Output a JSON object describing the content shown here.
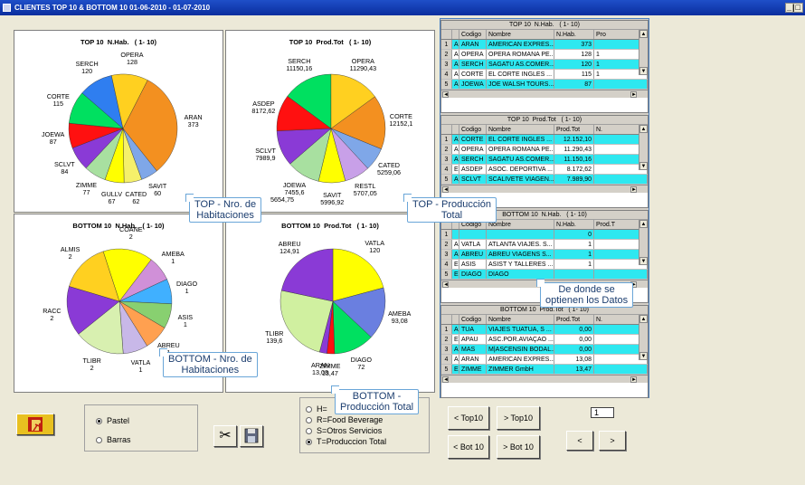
{
  "window": {
    "title": "CLIENTES TOP 10 & BOTTOM 10  01-06-2010 - 01-07-2010",
    "controls": "_|□"
  },
  "charts": {
    "top_hab": {
      "title": "TOP 10  N.Hab.   ( 1- 10)",
      "chart_data": {
        "type": "pie",
        "title": "TOP 10  N.Hab.   ( 1- 10)",
        "categories": [
          "ARAN",
          "SAVIT",
          "CATED",
          "GULLV",
          "ZIMME",
          "SCLVT",
          "JOEWA",
          "CORTE",
          "SERCH",
          "OPERA"
        ],
        "values": [
          373,
          60,
          62,
          67,
          77,
          84,
          87,
          115,
          120,
          128
        ],
        "colors": [
          "#f39020",
          "#7fa7e8",
          "#f5f06a",
          "#ffff00",
          "#a8e0a0",
          "#8a3ad6",
          "#ff1010",
          "#00e060",
          "#2f7ef0",
          "#ffd020"
        ]
      }
    },
    "top_prod": {
      "title": "TOP 10  Prod.Tot   ( 1- 10)",
      "chart_data": {
        "type": "pie",
        "title": "TOP 10  Prod.Tot   ( 1- 10)",
        "categories": [
          "CORTE",
          "CATED",
          "RESTL",
          "SAVIT",
          "JOEWA",
          "SCLVT",
          "ASDEP",
          "SERCH",
          "OPERA"
        ],
        "values": [
          12152.1,
          5259.06,
          5707.05,
          5996.92,
          7455.6,
          7989.9,
          8172.62,
          11150.16,
          11290.43
        ],
        "value_labels": [
          "12152,1",
          "5259,06",
          "5707,05",
          "5996,92",
          "7455,6",
          "7989,9",
          "8172,62",
          "11150,16",
          "11290,43"
        ],
        "extra_label": "5654,75",
        "colors": [
          "#f39020",
          "#7fa7e8",
          "#c8a0e8",
          "#ffff00",
          "#a8e0a0",
          "#8a3ad6",
          "#ff1010",
          "#00e060",
          "#ffd020"
        ]
      }
    },
    "bot_hab": {
      "title": "BOTTOM 10  N.Hab.   ( 1- 10)",
      "chart_data": {
        "type": "pie",
        "title": "BOTTOM 10  N.Hab.   ( 1- 10)",
        "categories": [
          "COANE",
          "AMEBA",
          "DIAGO",
          "ASIS",
          "ABREU",
          "VATLA",
          "TLIBR",
          "RACC",
          "ALMIS"
        ],
        "values": [
          2,
          1,
          1,
          1,
          1,
          1,
          2,
          2,
          2
        ],
        "colors": [
          "#ffff00",
          "#d090d8",
          "#40b0ff",
          "#88d070",
          "#ffa050",
          "#c8b8e8",
          "#d8f0b0",
          "#8a3ad6",
          "#ffd020"
        ]
      }
    },
    "bot_prod": {
      "title": "BOTTOM 10  Prod.Tot   ( 1- 10)",
      "chart_data": {
        "type": "pie",
        "title": "BOTTOM 10  Prod.Tot   ( 1- 10)",
        "categories": [
          "VATLA",
          "AMEBA",
          "DIAGO",
          "ZIMME",
          "ARAN",
          "TLIBR",
          "ABREU"
        ],
        "values": [
          120,
          93.08,
          72,
          13.47,
          13.08,
          139.6,
          124.91
        ],
        "value_labels": [
          "120",
          "93,08",
          "72",
          "13,47",
          "13,08",
          "139,6",
          "124,91"
        ],
        "colors": [
          "#ffff00",
          "#6a7fe0",
          "#00e060",
          "#ff1010",
          "#8a3ad6",
          "#d0f0a0",
          "#8a3ad6"
        ]
      }
    }
  },
  "callouts": {
    "top_hab": "TOP - Nro. de\nHabitaciones",
    "top_prod": "TOP - Producción\nTotal",
    "bot_hab": "BOTTOM - Nro. de\nHabitaciones",
    "bot_prod": "BOTTOM -\nProducción Total",
    "datos": "De donde se\noptienen los Datos"
  },
  "grids": [
    {
      "title": "TOP 10  N.Hab.   ( 1- 10)",
      "headers": [
        "",
        "",
        "Codigo",
        "Nombre",
        "N.Hab.",
        "Pro"
      ],
      "rows": [
        {
          "n": "1",
          "t": "A",
          "code": "ARAN",
          "name": "AMERICAN EXPRES...",
          "val": "373",
          "extra": "",
          "hl": true
        },
        {
          "n": "2",
          "t": "A",
          "code": "OPERA",
          "name": "OPERA ROMANA PE...",
          "val": "128",
          "extra": "1",
          "hl": false
        },
        {
          "n": "3",
          "t": "A",
          "code": "SERCH",
          "name": "SAGATU AS.COMER...",
          "val": "120",
          "extra": "1",
          "hl": true
        },
        {
          "n": "4",
          "t": "A",
          "code": "CORTE",
          "name": "EL CORTE INGLES ...",
          "val": "115",
          "extra": "1",
          "hl": false
        },
        {
          "n": "5",
          "t": "A",
          "code": "JOEWA",
          "name": "JOE WALSH TOURS...",
          "val": "87",
          "extra": "",
          "hl": true
        }
      ]
    },
    {
      "title": "TOP 10  Prod.Tot   ( 1- 10)",
      "headers": [
        "",
        "",
        "Codigo",
        "Nombre",
        "Prod.Tot",
        "N."
      ],
      "rows": [
        {
          "n": "1",
          "t": "A",
          "code": "CORTE",
          "name": "EL CORTE INGLES ...",
          "val": "12.152,10",
          "extra": "",
          "hl": true
        },
        {
          "n": "2",
          "t": "A",
          "code": "OPERA",
          "name": "OPERA ROMANA PE...",
          "val": "11.290,43",
          "extra": "",
          "hl": false
        },
        {
          "n": "3",
          "t": "A",
          "code": "SERCH",
          "name": "SAGATU AS.COMER...",
          "val": "11.150,16",
          "extra": "",
          "hl": true
        },
        {
          "n": "4",
          "t": "E",
          "code": "ASDEP",
          "name": "ASOC. DEPORTIVA ...",
          "val": "8.172,62",
          "extra": "",
          "hl": false
        },
        {
          "n": "5",
          "t": "A",
          "code": "SCLVT",
          "name": "SCALIVETE VIAGEN...",
          "val": "7.989,90",
          "extra": "",
          "hl": true
        }
      ]
    },
    {
      "title": "BOTTOM 10  N.Hab.   ( 1- 10)",
      "headers": [
        "",
        "",
        "Codigo",
        "Nombre",
        "N.Hab.",
        "Prod.T"
      ],
      "rows": [
        {
          "n": "1",
          "t": "",
          "code": "",
          "name": "",
          "val": "0",
          "extra": "",
          "hl": true
        },
        {
          "n": "2",
          "t": "A",
          "code": "VATLA",
          "name": "ATLANTA VIAJES. S...",
          "val": "1",
          "extra": "",
          "hl": false
        },
        {
          "n": "3",
          "t": "A",
          "code": "ABREU",
          "name": "ABREU VIAGENS S...",
          "val": "1",
          "extra": "",
          "hl": true
        },
        {
          "n": "4",
          "t": "E",
          "code": "ASIS",
          "name": "ASIST Y TALLERES ...",
          "val": "1",
          "extra": "",
          "hl": false
        },
        {
          "n": "5",
          "t": "E",
          "code": "DIAGO",
          "name": "DIAGO",
          "val": "",
          "extra": "",
          "hl": true
        }
      ]
    },
    {
      "title": "BOTTOM 10  Prod.Tot   ( 1- 10)",
      "headers": [
        "",
        "",
        "Codigo",
        "Nombre",
        "Prod.Tot",
        "N."
      ],
      "rows": [
        {
          "n": "1",
          "t": "A",
          "code": "TUA",
          "name": "VIAJES TUATUA, S ...",
          "val": "0,00",
          "extra": "",
          "hl": true
        },
        {
          "n": "2",
          "t": "E",
          "code": "APAU",
          "name": "ASC.POR.AVIAÇAO ...",
          "val": "0,00",
          "extra": "",
          "hl": false
        },
        {
          "n": "3",
          "t": "A",
          "code": "MAS",
          "name": "M|ASCENSIN BODAL...",
          "val": "0,00",
          "extra": "",
          "hl": true
        },
        {
          "n": "4",
          "t": "A",
          "code": "ARAN",
          "name": "AMERICAN EXPRES...",
          "val": "13,08",
          "extra": "",
          "hl": false
        },
        {
          "n": "5",
          "t": "E",
          "code": "ZIMME",
          "name": "ZIMMER GmbH",
          "val": "13,47",
          "extra": "",
          "hl": true
        }
      ]
    }
  ],
  "chart_type": {
    "options": [
      {
        "label": "Pastel",
        "selected": true
      },
      {
        "label": "Barras",
        "selected": false
      }
    ]
  },
  "metric": {
    "options": [
      {
        "label": "H=",
        "selected": false
      },
      {
        "label": "R=Food  Beverage",
        "selected": false
      },
      {
        "label": "S=Otros Servicios",
        "selected": false
      },
      {
        "label": "T=Produccion Total",
        "selected": true
      }
    ]
  },
  "nav": {
    "top_prev": "< Top10",
    "top_next": "> Top10",
    "bot_prev": "< Bot 10",
    "bot_next": "> Bot 10",
    "page_prev": "<",
    "page_next": ">",
    "page_value": "1"
  },
  "icons": {
    "exit": "exit-icon",
    "cut": "scissors-icon",
    "save": "save-icon"
  }
}
